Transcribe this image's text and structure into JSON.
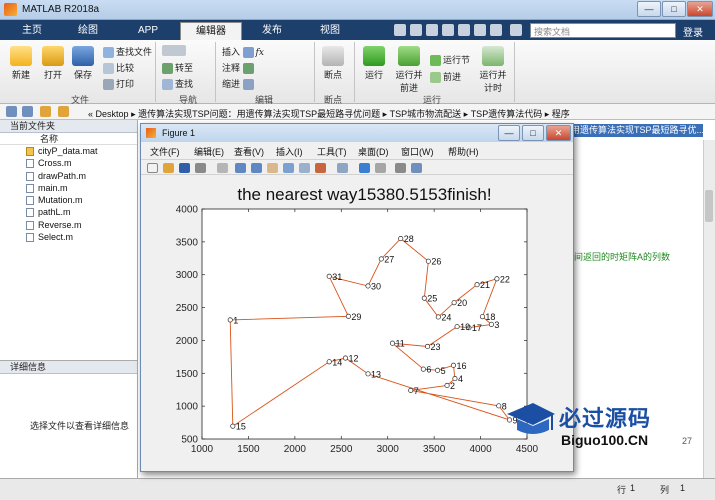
{
  "window": {
    "title": "MATLAB R2018a",
    "min": "—",
    "max": "□",
    "close": "✕"
  },
  "tabs": [
    "主页",
    "绘图",
    "APP",
    "编辑器",
    "发布",
    "视图"
  ],
  "active_tab": "编辑器",
  "search": {
    "placeholder": "搜索文档"
  },
  "login": "登录",
  "ribbon": {
    "file_group": {
      "new": "新建",
      "open": "打开",
      "save": "保存",
      "find_files": "查找文件",
      "compare": "比较",
      "print": "打印",
      "label": "文件"
    },
    "nav_group": {
      "goto": "转至",
      "find": "查找",
      "label": "导航"
    },
    "edit_group": {
      "insert": "插入",
      "comment": "注释",
      "indent": "缩进",
      "label": "编辑"
    },
    "breakpoint_group": {
      "breakpoints": "断点",
      "label": "断点"
    },
    "run_group": {
      "run": "运行",
      "run_advance": "运行并前进",
      "run_section": "运行节",
      "advance": "前进",
      "run_time": "运行并计时",
      "label": "运行"
    }
  },
  "breadcrumb": [
    "«",
    "Desktop",
    "遗传算法实现TSP问题：用遗传算法实现TSP最短路寻优问题",
    "TSP城市物流配送",
    "TSP遗传算法代码",
    "程序"
  ],
  "current_folder": {
    "title": "当前文件夹",
    "column": "名称",
    "files": [
      "cityP_data.mat",
      "Cross.m",
      "drawPath.m",
      "main.m",
      "Mutation.m",
      "pathL.m",
      "Reverse.m",
      "Select.m"
    ]
  },
  "details": {
    "title": "详细信息",
    "hint": "选择文件以查看详细信息"
  },
  "editor": {
    "tab_strip": "用遗传算法实现TSP最短路寻优...",
    "comment_fragment": "行间返回的时矩阵A的列数",
    "line_number": "27"
  },
  "figure": {
    "title": "Figure 1",
    "menu": [
      "文件(F)",
      "编辑(E)",
      "查看(V)",
      "插入(I)",
      "工具(T)",
      "桌面(D)",
      "窗口(W)",
      "帮助(H)"
    ]
  },
  "chart_data": {
    "type": "line",
    "title": "the nearest way15380.5153finish!",
    "xlim": [
      1000,
      4500
    ],
    "ylim": [
      500,
      4000
    ],
    "xticks": [
      1000,
      1500,
      2000,
      2500,
      3000,
      3500,
      4000,
      4500
    ],
    "yticks": [
      500,
      1000,
      1500,
      2000,
      2500,
      3000,
      3500,
      4000
    ],
    "grid": false,
    "line_color": "#d95319",
    "cities": [
      {
        "id": 1,
        "x": 1304,
        "y": 2312
      },
      {
        "id": 29,
        "x": 2577,
        "y": 2367
      },
      {
        "id": 31,
        "x": 2370,
        "y": 2975
      },
      {
        "id": 30,
        "x": 2788,
        "y": 2829
      },
      {
        "id": 27,
        "x": 2931,
        "y": 3240
      },
      {
        "id": 28,
        "x": 3140,
        "y": 3550
      },
      {
        "id": 26,
        "x": 3438,
        "y": 3205
      },
      {
        "id": 25,
        "x": 3394,
        "y": 2643
      },
      {
        "id": 24,
        "x": 3545,
        "y": 2357
      },
      {
        "id": 20,
        "x": 3715,
        "y": 2575
      },
      {
        "id": 21,
        "x": 3962,
        "y": 2848
      },
      {
        "id": 22,
        "x": 4176,
        "y": 2938
      },
      {
        "id": 18,
        "x": 4020,
        "y": 2362
      },
      {
        "id": 3,
        "x": 4117,
        "y": 2244
      },
      {
        "id": 17,
        "x": 3874,
        "y": 2193
      },
      {
        "id": 19,
        "x": 3747,
        "y": 2210
      },
      {
        "id": 23,
        "x": 3429,
        "y": 1908
      },
      {
        "id": 11,
        "x": 3051,
        "y": 1958
      },
      {
        "id": 6,
        "x": 3384,
        "y": 1563
      },
      {
        "id": 5,
        "x": 3537,
        "y": 1545
      },
      {
        "id": 16,
        "x": 3708,
        "y": 1621
      },
      {
        "id": 4,
        "x": 3724,
        "y": 1419
      },
      {
        "id": 2,
        "x": 3639,
        "y": 1315
      },
      {
        "id": 7,
        "x": 3248,
        "y": 1239
      },
      {
        "id": 13,
        "x": 2788,
        "y": 1491
      },
      {
        "id": 12,
        "x": 2545,
        "y": 1732
      },
      {
        "id": 14,
        "x": 2370,
        "y": 1675
      },
      {
        "id": 15,
        "x": 1332,
        "y": 695
      },
      {
        "id": 8,
        "x": 4196,
        "y": 1004
      },
      {
        "id": 9,
        "x": 4312,
        "y": 790
      }
    ],
    "route": [
      1,
      29,
      31,
      30,
      27,
      28,
      26,
      25,
      24,
      20,
      21,
      22,
      18,
      3,
      17,
      19,
      23,
      11,
      6,
      5,
      16,
      4,
      2,
      7,
      8,
      9,
      13,
      12,
      14,
      15,
      1
    ]
  },
  "status": {
    "row_label": "行",
    "row": "1",
    "col_label": "列",
    "col": "1"
  },
  "watermark": {
    "cn": "必过源码",
    "url": "Biguo100.CN"
  }
}
